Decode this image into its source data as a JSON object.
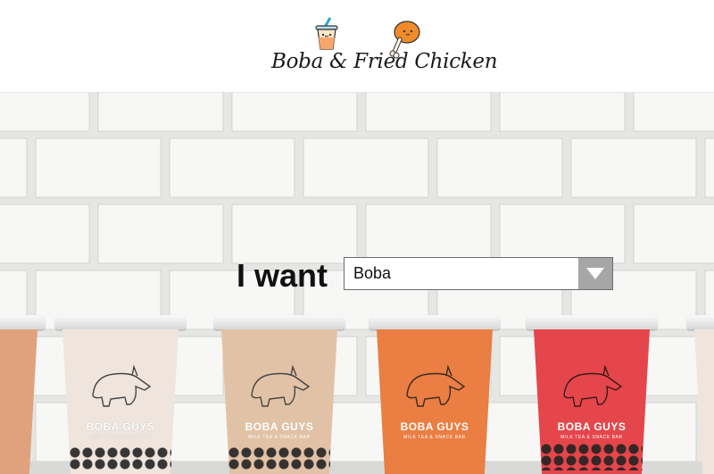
{
  "header": {
    "logo_text": "Boba & Fried Chicken"
  },
  "hero": {
    "cup_brand": "BOBA GUYS",
    "cup_subtitle": "MILK TEA & SNACK BAR",
    "cup_colors": [
      "#e0a27c",
      "#efe5dd",
      "#e2c2a6",
      "#ea7e43",
      "#e5464b"
    ]
  },
  "selector": {
    "label": "I want",
    "selected_value": "Boba"
  }
}
